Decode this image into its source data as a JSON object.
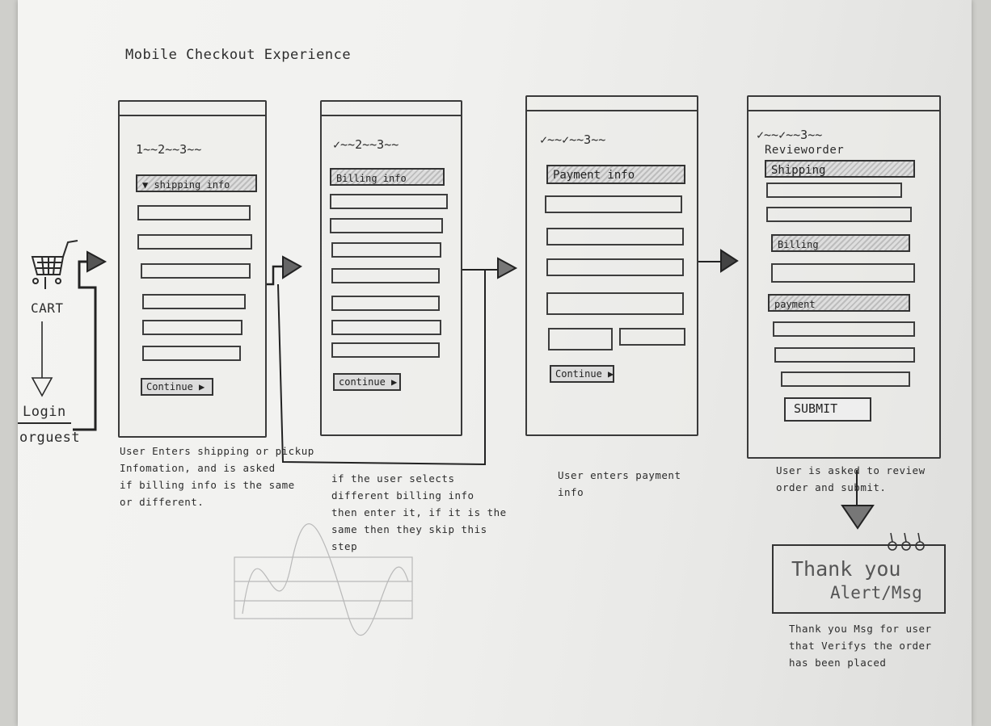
{
  "title": "Mobile Checkout Experience",
  "cart_label": "CART",
  "login_label": "Login",
  "guest_label": "orguest",
  "screens": [
    {
      "steps": "1~~2~~3~~",
      "section": "▼ shipping info",
      "button": "Continue ▶",
      "caption": "User Enters shipping or pickup\nInfomation, and is asked\nif billing info is the same\nor different."
    },
    {
      "steps": "✓~~2~~3~~",
      "section": "Billing info",
      "button": "continue ▶",
      "caption": "if the user selects\ndifferent billing info\nthen enter it, if it is the\nsame then they skip this\nstep"
    },
    {
      "steps": "✓~~✓~~3~~",
      "section": "Payment info",
      "button": "Continue ▶",
      "caption": "User enters payment\ninfo"
    },
    {
      "steps": "✓~~✓~~3~~",
      "review_title": "Revieworder",
      "shipping_label": "Shipping",
      "billing_label": "Billing",
      "payment_label": "payment",
      "button": "SUBMIT",
      "caption": "User is asked to review\norder and submit."
    }
  ],
  "thanks": {
    "line1": "Thank you",
    "line2": "Alert/Msg"
  },
  "thanks_caption": "Thank you Msg for user\nthat Verifys the order\nhas been placed"
}
